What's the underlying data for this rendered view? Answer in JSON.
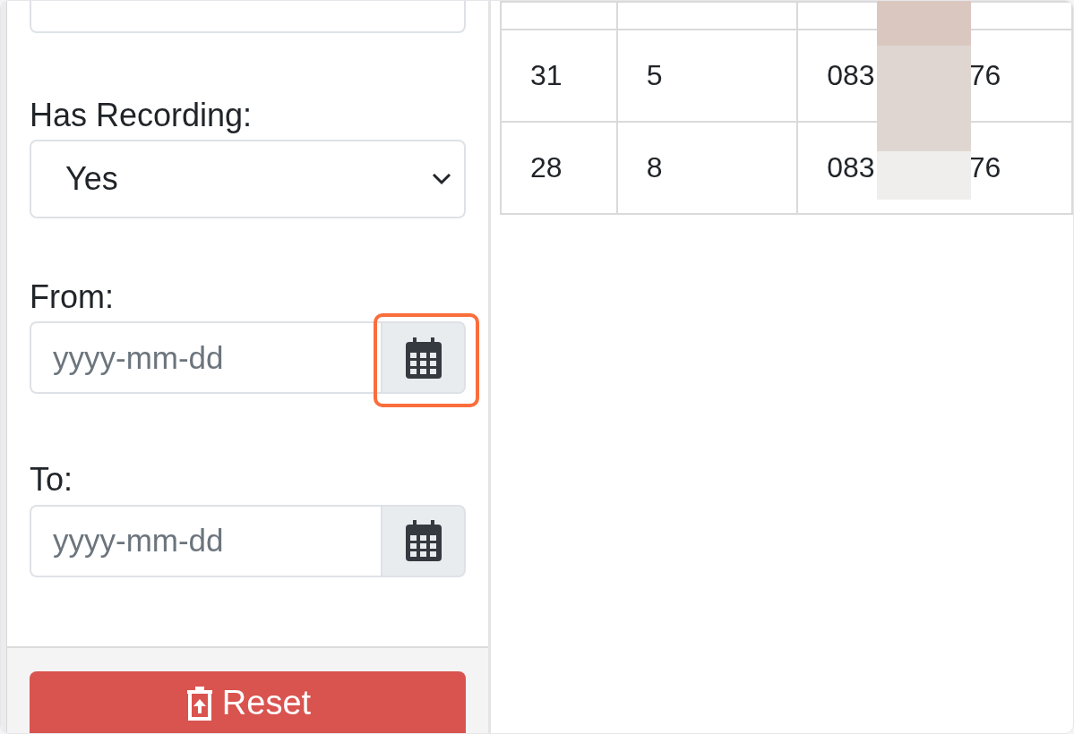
{
  "filters": {
    "has_recording": {
      "label": "Has Recording:",
      "value": "Yes"
    },
    "from": {
      "label": "From:",
      "placeholder": "yyyy-mm-dd",
      "highlighted": true
    },
    "to": {
      "label": "To:",
      "placeholder": "yyyy-mm-dd",
      "highlighted": false
    },
    "reset_button": "Reset"
  },
  "table": {
    "rows": [
      {
        "cut_off": true
      },
      {
        "cells": [
          "31",
          "5",
          {
            "start": "083",
            "end": "76"
          }
        ]
      },
      {
        "cells": [
          "28",
          "8",
          {
            "start": "083",
            "end": "76"
          }
        ]
      }
    ]
  }
}
